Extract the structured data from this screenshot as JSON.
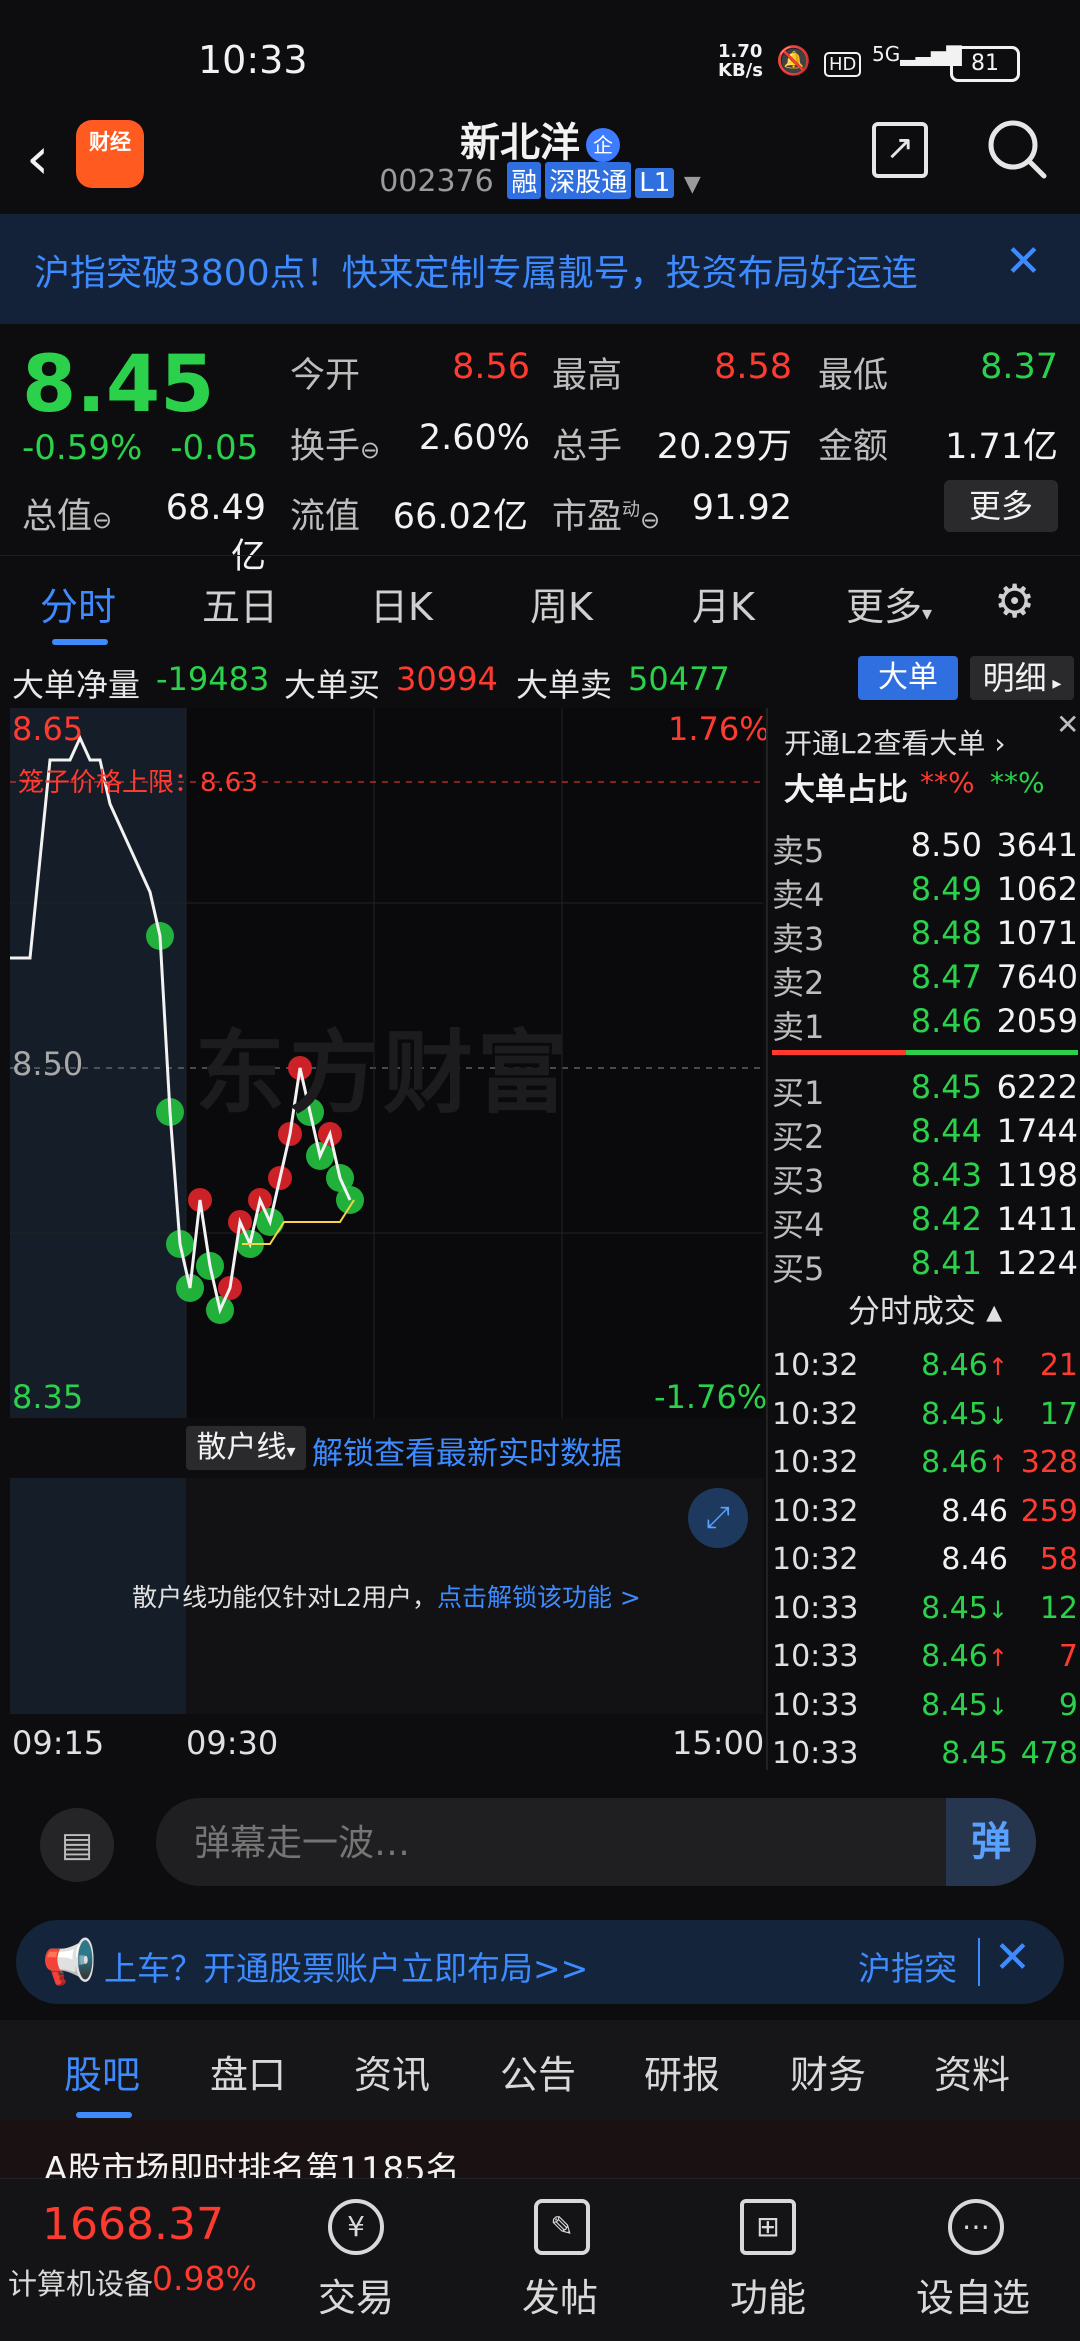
{
  "status": {
    "time": "10:33",
    "net_rate": "1.70",
    "net_unit": "KB/s",
    "hd": "HD",
    "signal": "5G",
    "battery": "81"
  },
  "header": {
    "title": "新北洋",
    "qi": "企",
    "code": "002376",
    "tags": [
      "融",
      "深股通",
      "L1"
    ],
    "logo_top": "",
    "logo_bottom": "财经"
  },
  "banner": {
    "text": "沪指突破3800点！快来定制专属靓号，投资布局好运连"
  },
  "quote": {
    "price": "8.45",
    "pct": "-0.59%",
    "chg": "-0.05",
    "labels": {
      "open": "今开",
      "high": "最高",
      "low": "最低",
      "turnover": "换手",
      "volume": "总手",
      "amount": "金额",
      "mktcap": "总值",
      "float": "流值",
      "pe": "市盈",
      "pe_sup": "动"
    },
    "values": {
      "open": "8.56",
      "high": "8.58",
      "low": "8.37",
      "turnover": "2.60%",
      "volume": "20.29万",
      "amount": "1.71亿",
      "mktcap": "68.49亿",
      "float": "66.02亿",
      "pe": "91.92"
    },
    "more": "更多"
  },
  "tabs": [
    "分时",
    "五日",
    "日K",
    "周K",
    "月K",
    "更多"
  ],
  "bigorder": {
    "net_label": "大单净量",
    "net": "-19483",
    "buy_label": "大单买",
    "buy": "30994",
    "sell_label": "大单卖",
    "sell": "50477",
    "btn1": "大单",
    "btn2": "明细"
  },
  "chart": {
    "y_top": "8.65",
    "y_mid": "8.50",
    "y_bot": "8.35",
    "pct_top": "1.76%",
    "pct_bot": "-1.76%",
    "cage": "笼子价格上限：8.63",
    "watermark": "东方财富",
    "sub_label": "散户线",
    "unlock": "解锁查看最新实时数据",
    "sub_msg": "散户线功能仅针对L2用户，",
    "sub_link": "点击解锁该功能 >",
    "times": [
      "09:15",
      "09:30",
      "15:00"
    ]
  },
  "chart_data": {
    "type": "line",
    "ylim": [
      8.35,
      8.65
    ],
    "y_ref": 8.5,
    "price_series": [
      8.55,
      8.55,
      8.64,
      8.64,
      8.65,
      8.64,
      8.64,
      8.62,
      8.61,
      8.6,
      8.59,
      8.58,
      8.56,
      8.48,
      8.42,
      8.4,
      8.44,
      8.41,
      8.39,
      8.4,
      8.43,
      8.42,
      8.44,
      8.43,
      8.45,
      8.47,
      8.5,
      8.48,
      8.46,
      8.47,
      8.45,
      8.44
    ],
    "avg_series": [
      8.42,
      8.42,
      8.42,
      8.43,
      8.43,
      8.43,
      8.43,
      8.43,
      8.44
    ]
  },
  "orderbook": {
    "header1": "开通L2查看大单",
    "header2": "大单占比",
    "hidden": "**%",
    "asks": [
      {
        "l": "卖5",
        "p": "8.50",
        "v": "3641"
      },
      {
        "l": "卖4",
        "p": "8.49",
        "v": "1062"
      },
      {
        "l": "卖3",
        "p": "8.48",
        "v": "1071"
      },
      {
        "l": "卖2",
        "p": "8.47",
        "v": "7640"
      },
      {
        "l": "卖1",
        "p": "8.46",
        "v": "2059"
      }
    ],
    "bids": [
      {
        "l": "买1",
        "p": "8.45",
        "v": "6222"
      },
      {
        "l": "买2",
        "p": "8.44",
        "v": "1744"
      },
      {
        "l": "买3",
        "p": "8.43",
        "v": "1198"
      },
      {
        "l": "买4",
        "p": "8.42",
        "v": "1411"
      },
      {
        "l": "买5",
        "p": "8.41",
        "v": "1224"
      }
    ],
    "ticks_title": "分时成交",
    "ticks": [
      {
        "t": "10:32",
        "p": "8.46",
        "a": "↑",
        "v": "21",
        "c": "red"
      },
      {
        "t": "10:32",
        "p": "8.45",
        "a": "↓",
        "v": "17",
        "c": "green"
      },
      {
        "t": "10:32",
        "p": "8.46",
        "a": "↑",
        "v": "328",
        "c": "red"
      },
      {
        "t": "10:32",
        "p": "8.46",
        "a": "",
        "v": "259",
        "c": "red"
      },
      {
        "t": "10:32",
        "p": "8.46",
        "a": "",
        "v": "58",
        "c": "red"
      },
      {
        "t": "10:33",
        "p": "8.45",
        "a": "↓",
        "v": "12",
        "c": "green"
      },
      {
        "t": "10:33",
        "p": "8.46",
        "a": "↑",
        "v": "7",
        "c": "red"
      },
      {
        "t": "10:33",
        "p": "8.45",
        "a": "↓",
        "v": "9",
        "c": "green"
      },
      {
        "t": "10:33",
        "p": "8.45",
        "a": "",
        "v": "478",
        "c": "green"
      }
    ]
  },
  "danmu": {
    "placeholder": "弹幕走一波…",
    "btn": "弹"
  },
  "ad": {
    "text": "上车？开通股票账户立即布局>>",
    "text2": "沪指突"
  },
  "btabs": [
    "股吧",
    "盘口",
    "资讯",
    "公告",
    "研报",
    "财务",
    "资料"
  ],
  "peek": "A股市场即时排名第1185名",
  "nav": {
    "idx_val": "1668.37",
    "idx_name": "计算机设备",
    "idx_chg": "0.98%",
    "items": [
      "交易",
      "发帖",
      "功能",
      "设自选"
    ]
  }
}
